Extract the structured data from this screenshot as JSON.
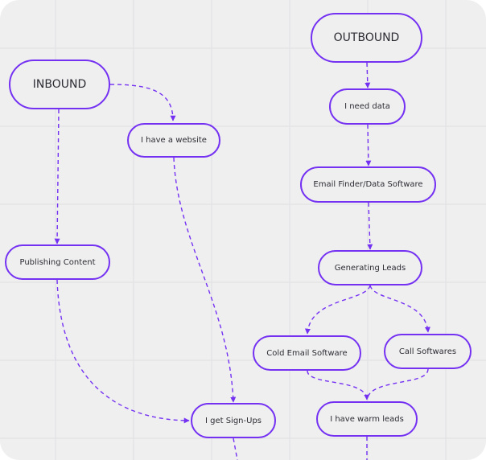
{
  "diagram": {
    "accent_color": "#7431f2",
    "background_color": "#efeff0",
    "grid_color": "#e2e2e4",
    "nodes": {
      "inbound": "INBOUND",
      "outbound": "OUTBOUND",
      "website": "I have a website",
      "need_data": "I need data",
      "email_finder": "Email Finder/Data Software",
      "publishing": "Publishing Content",
      "generating": "Generating Leads",
      "cold_email": "Cold Email Software",
      "call": "Call Softwares",
      "signups": "I get Sign-Ups",
      "warm_leads": "I have warm leads"
    },
    "edges": [
      {
        "from": "inbound",
        "to": "website"
      },
      {
        "from": "inbound",
        "to": "publishing"
      },
      {
        "from": "website",
        "to": "signups"
      },
      {
        "from": "publishing",
        "to": "signups"
      },
      {
        "from": "outbound",
        "to": "need_data"
      },
      {
        "from": "need_data",
        "to": "email_finder"
      },
      {
        "from": "email_finder",
        "to": "generating"
      },
      {
        "from": "generating",
        "to": "cold_email"
      },
      {
        "from": "generating",
        "to": "call"
      },
      {
        "from": "cold_email",
        "to": "warm_leads"
      },
      {
        "from": "call",
        "to": "warm_leads"
      },
      {
        "from": "signups",
        "to": "offscreen"
      },
      {
        "from": "warm_leads",
        "to": "offscreen"
      }
    ]
  }
}
